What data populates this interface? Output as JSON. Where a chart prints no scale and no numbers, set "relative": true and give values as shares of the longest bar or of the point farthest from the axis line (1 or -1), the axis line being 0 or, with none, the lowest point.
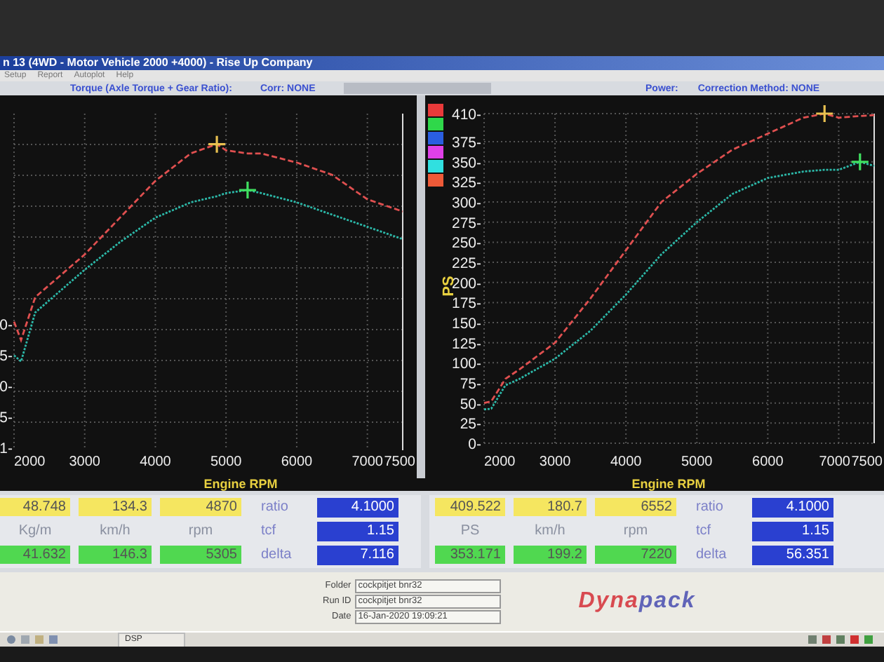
{
  "window": {
    "title": "n 13 (4WD - Motor Vehicle 2000 +4000) - Rise Up Company"
  },
  "menu": [
    "Setup",
    "Report",
    "Autoplot",
    "Help"
  ],
  "torque_panel": {
    "heading": "Torque (Axle Torque + Gear Ratio):",
    "correction": "Corr: NONE",
    "chart_data": {
      "type": "line",
      "xlabel": "Engine RPM",
      "grid": true,
      "x": [
        2000,
        2100,
        2300,
        2800,
        3000,
        3500,
        4000,
        4500,
        4870,
        5000,
        5305,
        5500,
        6000,
        6500,
        7000,
        7500
      ],
      "series": [
        {
          "color": "#e05050",
          "line_style": "dashed",
          "values": [
            0.42,
            0.36,
            0.5,
            0.6,
            0.64,
            0.76,
            0.88,
            0.97,
            1,
            0.98,
            0.97,
            0.97,
            0.94,
            0.9,
            0.82,
            0.78
          ]
        },
        {
          "color": "#2cb8a8",
          "line_style": "dotted",
          "values": [
            0.31,
            0.29,
            0.45,
            0.55,
            0.59,
            0.68,
            0.76,
            0.81,
            0.83,
            0.84,
            0.85,
            0.84,
            0.81,
            0.77,
            0.73,
            0.69
          ]
        }
      ],
      "xlim": [
        2000,
        7500
      ],
      "relative": true,
      "xticks": [
        2000,
        3000,
        4000,
        5000,
        6000,
        7000,
        7500
      ]
    },
    "y_tick_labels": [
      "0-",
      "5-",
      "0-",
      "5-",
      "1-"
    ]
  },
  "power_panel": {
    "heading": "Power:",
    "correction": "Correction Method: NONE",
    "legend": [
      {
        "color": "#e83a3a"
      },
      {
        "color": "#2fd84a"
      },
      {
        "color": "#2a5ee0"
      },
      {
        "color": "#e040e8"
      },
      {
        "color": "#30e0e0"
      },
      {
        "color": "#ee5a38"
      }
    ],
    "chart_data": {
      "type": "line",
      "ylabel": "PS",
      "xlabel": "Engine RPM",
      "grid": true,
      "x": [
        2000,
        2100,
        2300,
        2500,
        3000,
        3500,
        4000,
        4500,
        5000,
        5500,
        6000,
        6500,
        6800,
        7000,
        7300,
        7500
      ],
      "series": [
        {
          "color": "#e05050",
          "line_style": "dashed",
          "values": [
            50,
            52,
            80,
            92,
            125,
            180,
            240,
            300,
            335,
            365,
            385,
            405,
            410,
            405,
            407,
            408
          ]
        },
        {
          "color": "#2cb8a8",
          "line_style": "dotted",
          "values": [
            42,
            43,
            72,
            80,
            105,
            140,
            185,
            235,
            275,
            310,
            330,
            338,
            340,
            340,
            350,
            345
          ]
        }
      ],
      "xlim": [
        2000,
        7500
      ],
      "ylim": [
        0,
        410
      ],
      "xticks": [
        2000,
        3000,
        4000,
        5000,
        6000,
        7000,
        7500
      ],
      "yticks": [
        {
          "value": 0,
          "label": "0-"
        },
        {
          "value": 25,
          "label": "25-"
        },
        {
          "value": 50,
          "label": "50-"
        },
        {
          "value": 75,
          "label": "75-"
        },
        {
          "value": 100,
          "label": "100-"
        },
        {
          "value": 125,
          "label": "125-"
        },
        {
          "value": 150,
          "label": "150-"
        },
        {
          "value": 175,
          "label": "175-"
        },
        {
          "value": 200,
          "label": "200-"
        },
        {
          "value": 225,
          "label": "225-"
        },
        {
          "value": 250,
          "label": "250-"
        },
        {
          "value": 275,
          "label": "275-"
        },
        {
          "value": 300,
          "label": "300-"
        },
        {
          "value": 325,
          "label": "325-"
        },
        {
          "value": 350,
          "label": "350-"
        },
        {
          "value": 375,
          "label": "375-"
        },
        {
          "value": 410,
          "label": "410-"
        }
      ]
    }
  },
  "readouts": [
    {
      "rows": [
        {
          "kind": "peak",
          "values": [
            "48.748",
            "134.3",
            "4870"
          ]
        },
        {
          "kind": "units",
          "values": [
            "Kg/m",
            "km/h",
            "rpm"
          ]
        },
        {
          "kind": "cursor",
          "values": [
            "41.632",
            "146.3",
            "5305"
          ]
        }
      ],
      "params": [
        {
          "label": "ratio",
          "value": "4.1000"
        },
        {
          "label": "tcf",
          "value": "1.15"
        },
        {
          "label": "delta",
          "value": "7.116"
        }
      ]
    },
    {
      "rows": [
        {
          "kind": "peak",
          "values": [
            "409.522",
            "180.7",
            "6552"
          ]
        },
        {
          "kind": "units",
          "values": [
            "PS",
            "km/h",
            "rpm"
          ]
        },
        {
          "kind": "cursor",
          "values": [
            "353.171",
            "199.2",
            "7220"
          ]
        }
      ],
      "params": [
        {
          "label": "ratio",
          "value": "4.1000"
        },
        {
          "label": "tcf",
          "value": "1.15"
        },
        {
          "label": "delta",
          "value": "56.351"
        }
      ]
    }
  ],
  "run_info": [
    {
      "label": "Folder",
      "value": "cockpitjet bnr32"
    },
    {
      "label": "Run ID",
      "value": "cockpitjet bnr32"
    },
    {
      "label": "Date",
      "value": "16-Jan-2020 19:09:21"
    }
  ],
  "logo": {
    "first": "Dyna",
    "second": "pack"
  },
  "taskbar": {
    "task": "DSP"
  }
}
